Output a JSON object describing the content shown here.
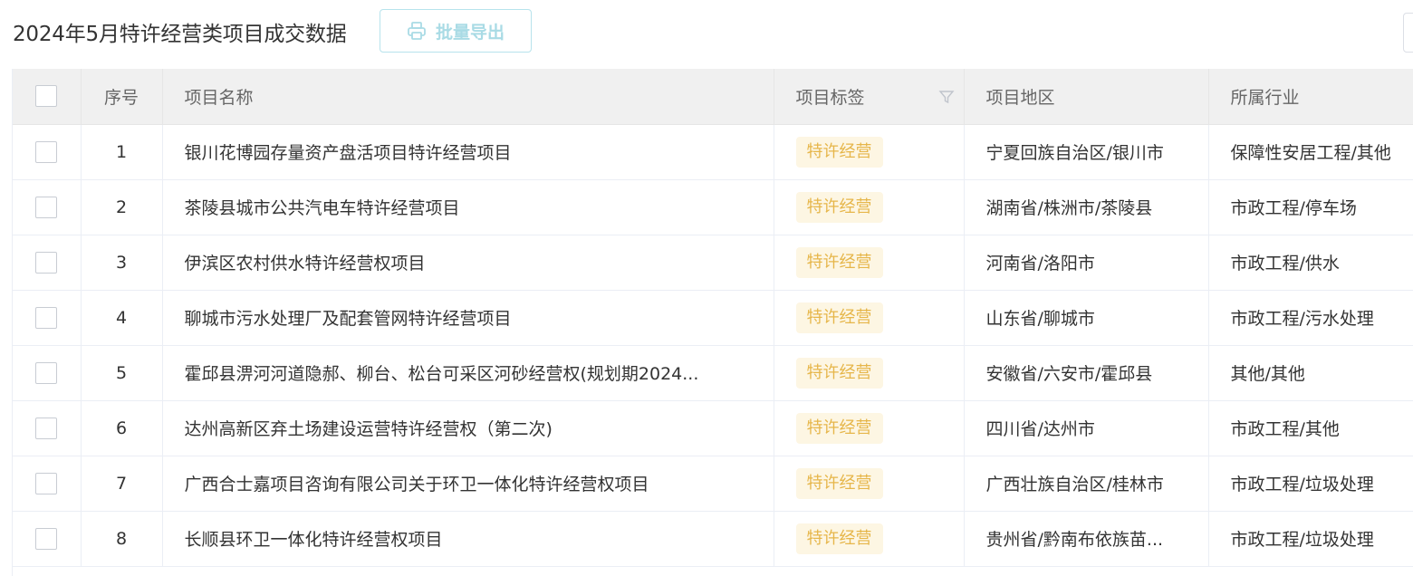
{
  "header": {
    "title": "2024年5月特许经营类项目成交数据",
    "export_label": "批量导出"
  },
  "table": {
    "columns": {
      "index": "序号",
      "name": "项目名称",
      "tag": "项目标签",
      "region": "项目地区",
      "industry": "所属行业"
    },
    "rows": [
      {
        "index": "1",
        "name": "银川花博园存量资产盘活项目特许经营项目",
        "tag": "特许经营",
        "region": "宁夏回族自治区/银川市",
        "industry": "保障性安居工程/其他"
      },
      {
        "index": "2",
        "name": "茶陵县城市公共汽电车特许经营项目",
        "tag": "特许经营",
        "region": "湖南省/株洲市/茶陵县",
        "industry": "市政工程/停车场"
      },
      {
        "index": "3",
        "name": "伊滨区农村供水特许经营权项目",
        "tag": "特许经营",
        "region": "河南省/洛阳市",
        "industry": "市政工程/供水"
      },
      {
        "index": "4",
        "name": "聊城市污水处理厂及配套管网特许经营项目",
        "tag": "特许经营",
        "region": "山东省/聊城市",
        "industry": "市政工程/污水处理"
      },
      {
        "index": "5",
        "name": "霍邱县淠河河道隐郝、柳台、松台可采区河砂经营权(规划期2024...",
        "tag": "特许经营",
        "region": "安徽省/六安市/霍邱县",
        "industry": "其他/其他"
      },
      {
        "index": "6",
        "name": "达州高新区弃土场建设运营特许经营权（第二次)",
        "tag": "特许经营",
        "region": "四川省/达州市",
        "industry": "市政工程/其他"
      },
      {
        "index": "7",
        "name": "广西合士嘉项目咨询有限公司关于环卫一体化特许经营权项目",
        "tag": "特许经营",
        "region": "广西壮族自治区/桂林市",
        "industry": "市政工程/垃圾处理"
      },
      {
        "index": "8",
        "name": "长顺县环卫一体化特许经营权项目",
        "tag": "特许经营",
        "region": "贵州省/黔南布依族苗...",
        "industry": "市政工程/垃圾处理"
      }
    ]
  },
  "icons": {
    "export": "printer-icon",
    "filter": "filter-icon"
  },
  "colors": {
    "tag_bg": "#fdf6e3",
    "tag_text": "#e6b64a",
    "export_border": "#b7e3ec",
    "export_text": "#a9dbe5",
    "header_bg": "#f0f0f0"
  }
}
